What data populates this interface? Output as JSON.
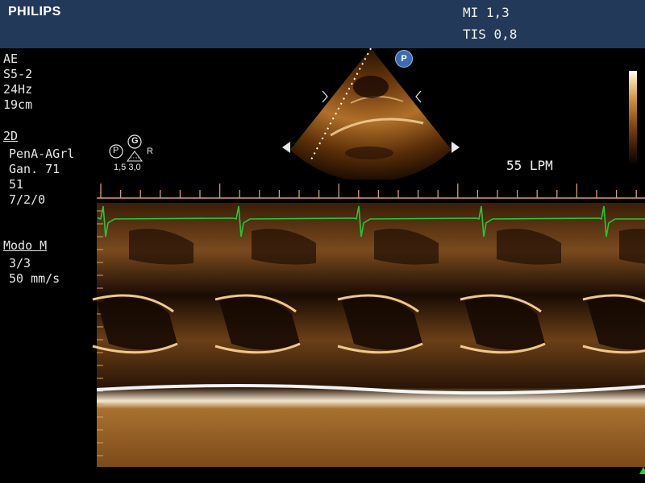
{
  "header": {
    "brand": "PHILIPS",
    "mi_label": "MI 1,3",
    "tis_label": "TIS 0,8"
  },
  "probe_info": {
    "preset": "AE",
    "transducer": "S5-2",
    "frame_rate": "24Hz",
    "depth": "19cm"
  },
  "twod_settings": {
    "title": "2D",
    "mode": "PenA-AGrl",
    "gain": "Gan. 71",
    "dynamic_range": "51",
    "persistence": "7/2/0"
  },
  "mmode_settings": {
    "title": "Modo M",
    "filter": "3/3",
    "sweep_speed": "50 mm/s"
  },
  "heart_rate": "55 LPM",
  "orientation": {
    "p_letter": "P",
    "g_letter": "G",
    "r_letter": "R",
    "focus_values": "1,5 3,0"
  },
  "probe_badge": "P",
  "colors": {
    "header_bg": "#23395a",
    "ecg_trace": "#22c83a",
    "tissue": "#c98538",
    "badge": "#3a6cb5"
  },
  "ecg": {
    "beat_count": 5
  }
}
